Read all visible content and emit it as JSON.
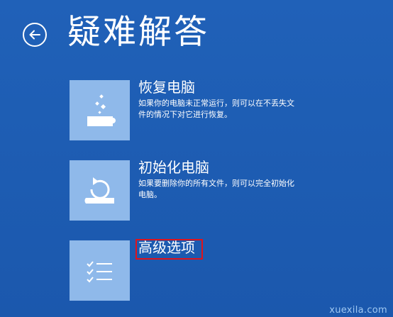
{
  "header": {
    "title": "疑难解答"
  },
  "options": [
    {
      "title": "恢复电脑",
      "description": "如果你的电脑未正常运行，则可以在不丢失文件的情况下对它进行恢复。",
      "icon": "refresh-pc-icon"
    },
    {
      "title": "初始化电脑",
      "description": "如果要删除你的所有文件，则可以完全初始化电脑。",
      "icon": "reset-pc-icon"
    },
    {
      "title": "高级选项",
      "icon": "checklist-icon",
      "highlight_color": "#e0131b"
    }
  ],
  "colors": {
    "background": "#1e5cb3",
    "tile": "#8fb9ea",
    "text": "#ffffff"
  },
  "watermark": "xuexila.com"
}
